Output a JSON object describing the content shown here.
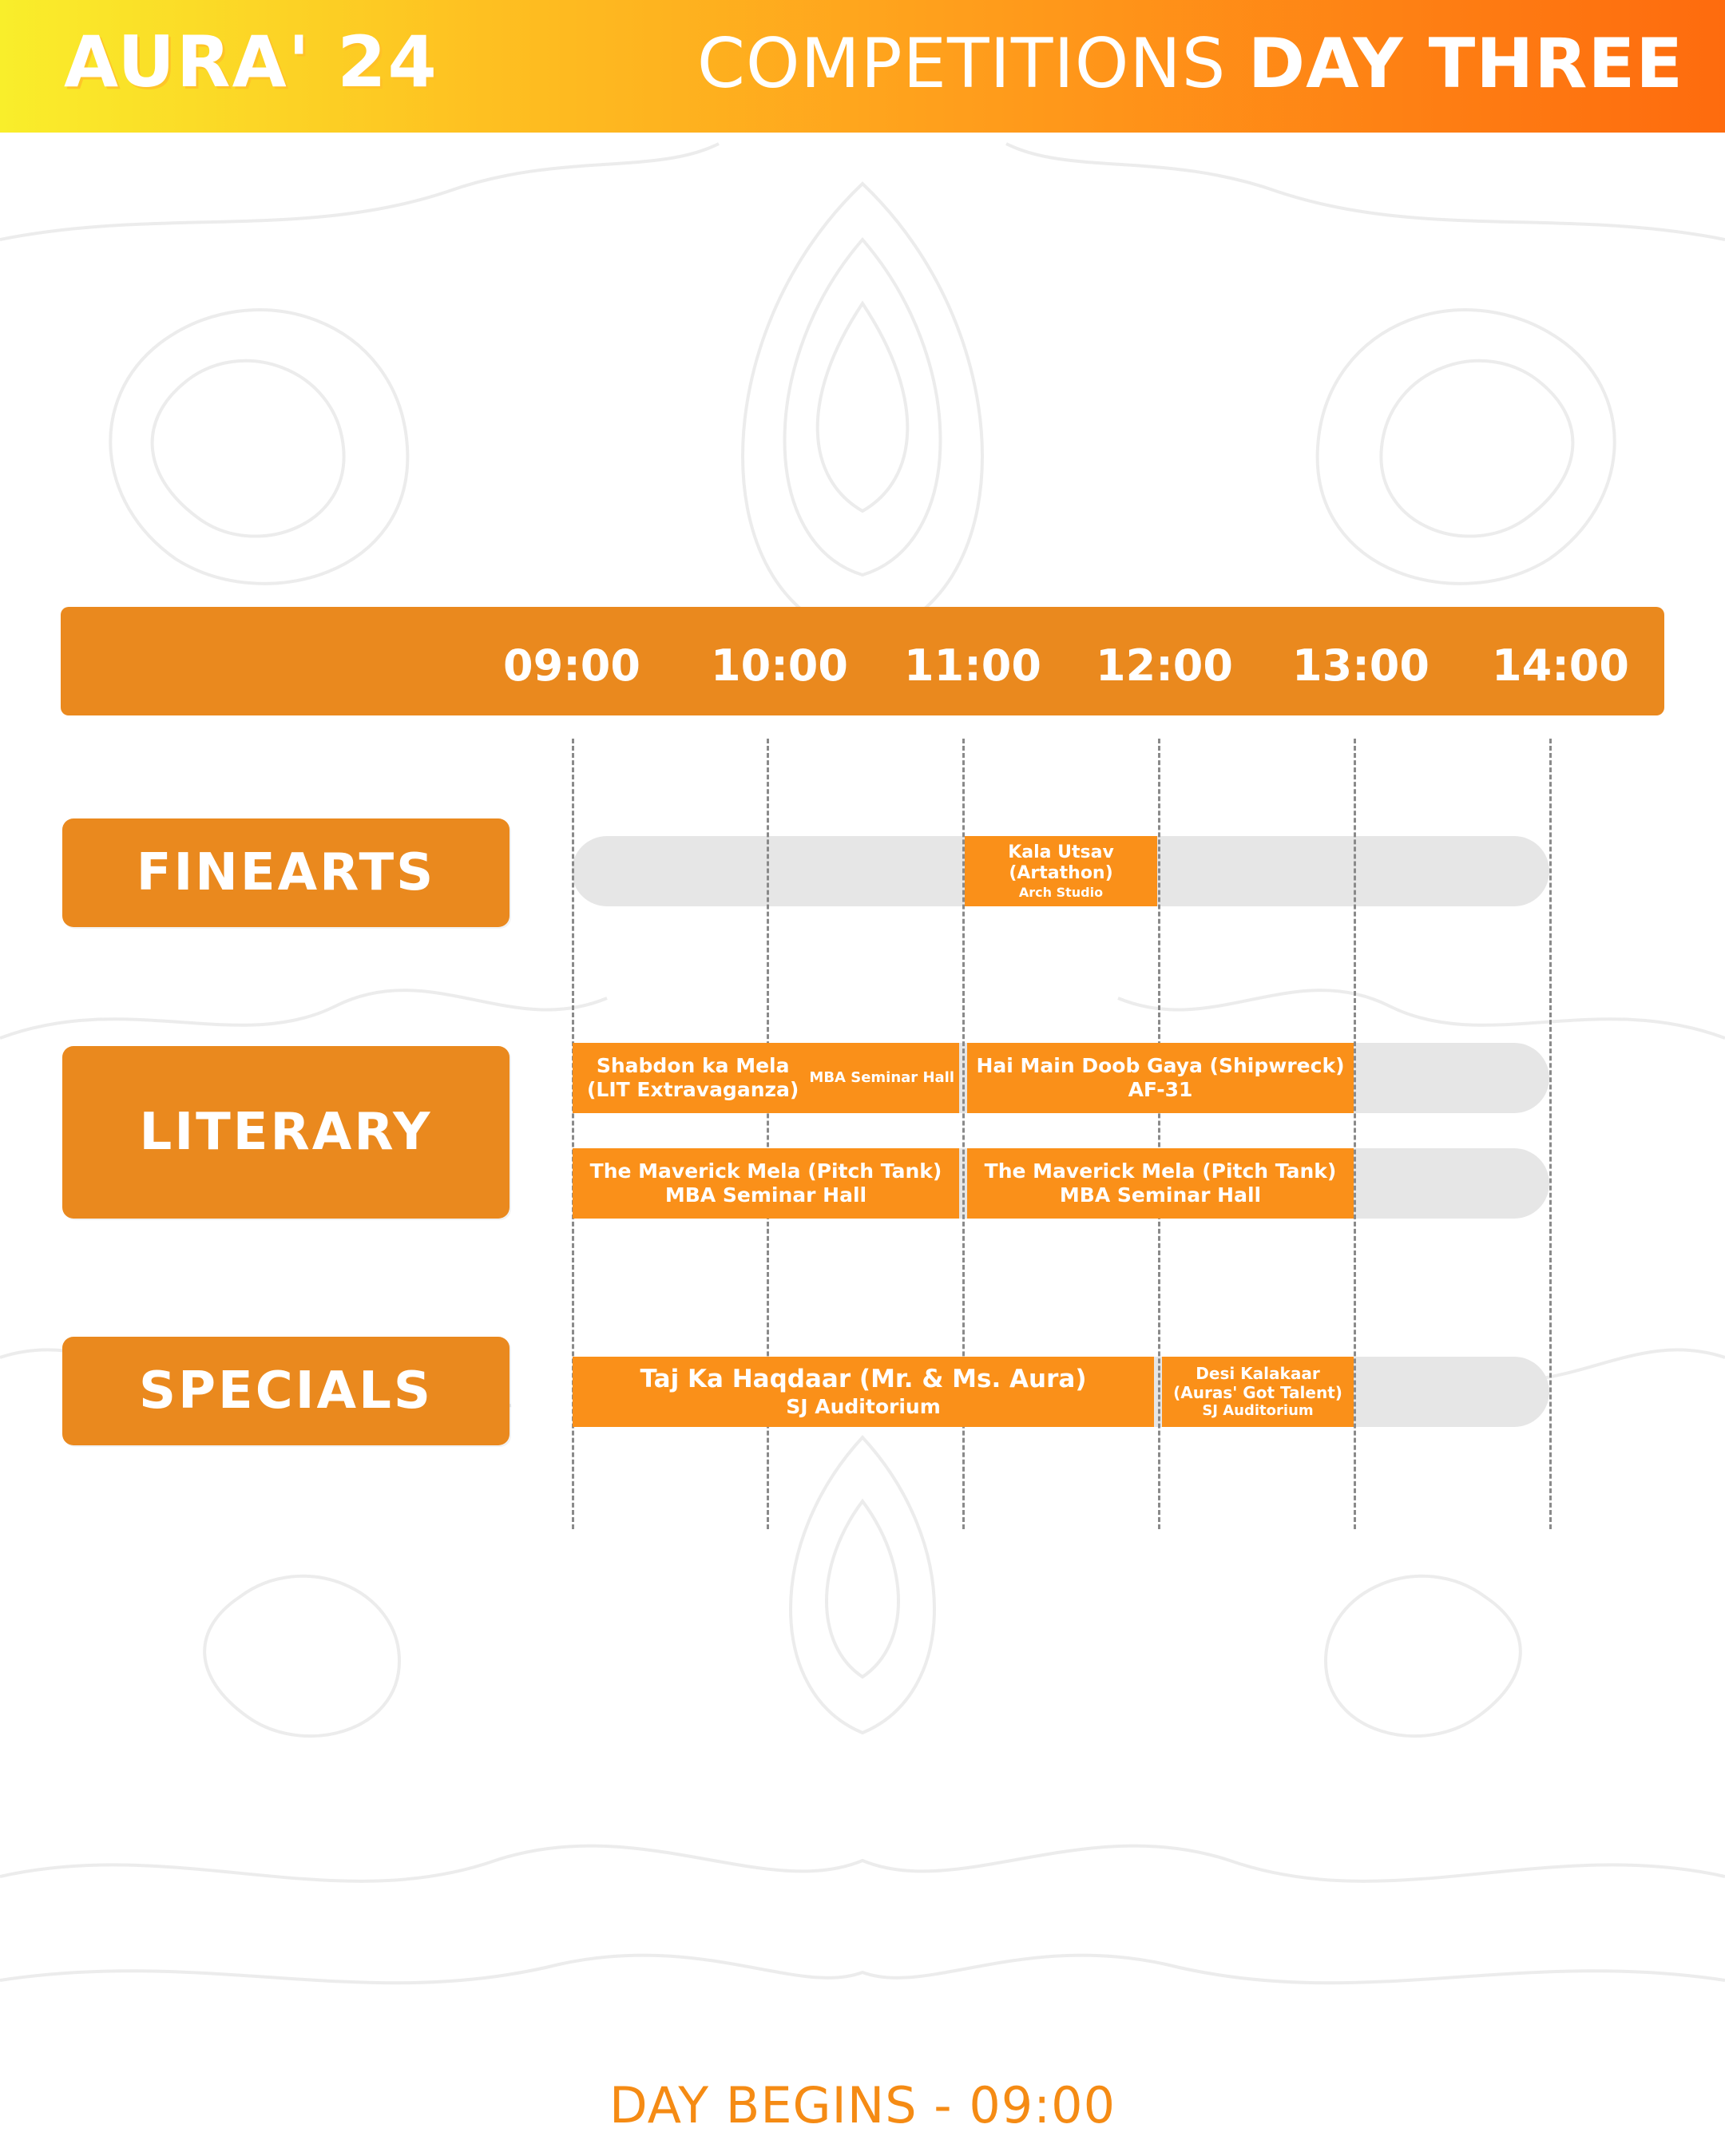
{
  "header": {
    "brand": "AURA' 24",
    "heading_light": "COMPETITIONS",
    "heading_bold": "DAY THREE"
  },
  "timeline": {
    "times": [
      "09:00",
      "10:00",
      "11:00",
      "12:00",
      "13:00",
      "14:00"
    ]
  },
  "categories": [
    "FINEARTS",
    "LITERARY",
    "SPECIALS"
  ],
  "events": {
    "kala_utsav": {
      "title1": "Kala Utsav",
      "title2": "(Artathon)",
      "venue": "Arch Studio"
    },
    "shabdon": {
      "title1": "Shabdon ka Mela",
      "title2": "(LIT Extravaganza)",
      "venue": "MBA Seminar Hall"
    },
    "shipwreck": {
      "title": "Hai Main Doob Gaya (Shipwreck)",
      "venue": "AF-31"
    },
    "maverick_1": {
      "title": "The Maverick Mela (Pitch Tank)",
      "venue": "MBA Seminar Hall"
    },
    "maverick_2": {
      "title": "The Maverick Mela (Pitch Tank)",
      "venue": "MBA Seminar Hall"
    },
    "taj": {
      "title": "Taj Ka Haqdaar (Mr. & Ms. Aura)",
      "venue": "SJ Auditorium"
    },
    "desi": {
      "title1": "Desi Kalakaar",
      "title2": "(Auras' Got Talent)",
      "venue": "SJ Auditorium"
    }
  },
  "footer": {
    "text": "DAY BEGINS - 09:00"
  },
  "colors": {
    "category_orange": "#ea891e",
    "event_orange": "#fa9019",
    "track_grey": "#e6e6e6",
    "header_gradient_start": "#f9ee2b",
    "header_gradient_end": "#fe6b0e"
  }
}
